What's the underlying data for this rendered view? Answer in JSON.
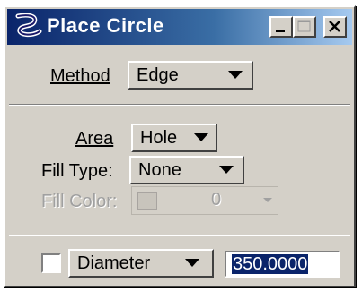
{
  "window": {
    "title": "Place Circle",
    "buttons": {
      "minimize": "minimize",
      "maximize": "maximize",
      "close": "close"
    }
  },
  "method": {
    "label": "Method",
    "value": "Edge"
  },
  "area": {
    "label": "Area",
    "value": "Hole"
  },
  "fill_type": {
    "label": "Fill Type:",
    "value": "None"
  },
  "fill_color": {
    "label": "Fill Color:",
    "value": "0"
  },
  "size": {
    "mode": "Diameter",
    "value": "350.0000",
    "checked": false
  },
  "colors": {
    "title_start": "#0a246a",
    "title_end": "#a6caf0",
    "face": "#d4d0c8"
  }
}
